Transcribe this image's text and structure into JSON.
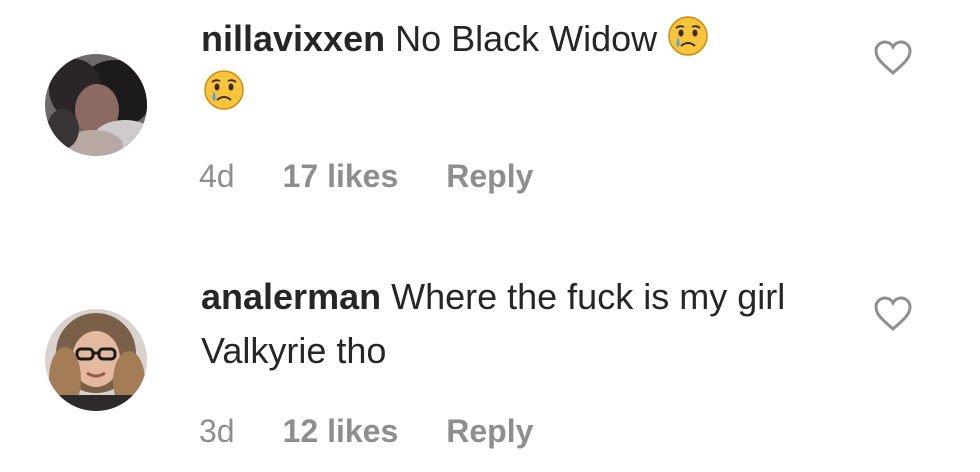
{
  "comments": [
    {
      "username": "nillavixxen",
      "text_before_emoji": " No Black Widow ",
      "emoji_icon": "crying-face-emoji",
      "age": "4d",
      "likes": "17 likes",
      "reply_label": "Reply"
    },
    {
      "username": "analerman",
      "text": " Where the fuck is my girl Valkyrie tho",
      "age": "3d",
      "likes": "12 likes",
      "reply_label": "Reply"
    }
  ],
  "colors": {
    "primary_text": "#262626",
    "secondary_text": "#8e8e8e",
    "heart_outline": "#8e8e8e"
  }
}
